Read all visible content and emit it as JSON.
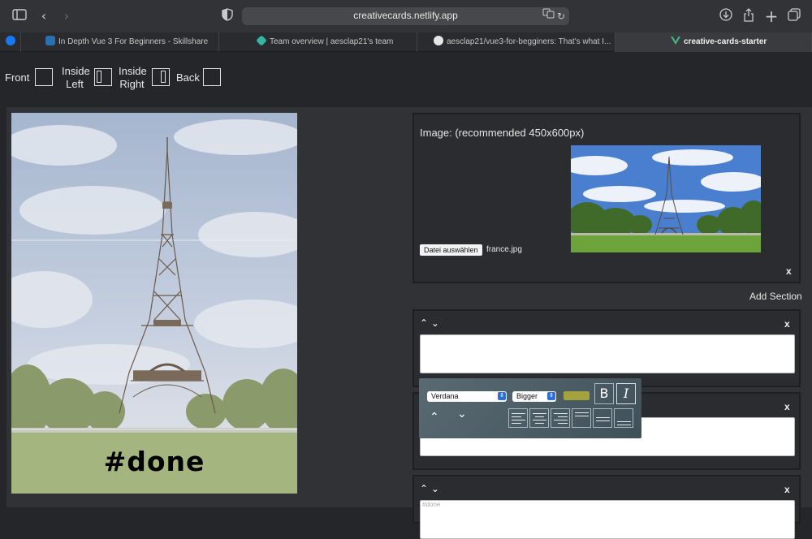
{
  "browser": {
    "url": "creativecards.netlify.app",
    "tabs": [
      {
        "label": "In Depth Vue 3 For Beginners - Skillshare",
        "icon_color": "#2a6fb0"
      },
      {
        "label": "Team overview | aesclap21's team",
        "icon_color": "#32b5a1"
      },
      {
        "label": "aesclap21/vue3-for-begginers: That's what I...",
        "icon_color": "#e6e6e6"
      },
      {
        "label": "creative-cards-starter",
        "icon_color": "#42b883"
      }
    ]
  },
  "pages": {
    "front": "Front",
    "inside_left": "Inside\nLeft",
    "inside_right": "Inside\nRight",
    "back": "Back"
  },
  "card": {
    "text": "#done"
  },
  "image_section": {
    "title": "Image: (recommended 450x600px)",
    "file_button": "Datei auswählen",
    "file_name": "france.jpg",
    "close": "x"
  },
  "add_section": "Add Section",
  "text_sections": [
    {
      "close": "x",
      "value": "",
      "placeholder": ""
    },
    {
      "close": "x",
      "value": "",
      "placeholder": ""
    },
    {
      "close": "x",
      "value": "",
      "placeholder": "#done"
    }
  ],
  "format_popup": {
    "font": "Verdana",
    "size": "Bigger",
    "color": "#a3a23f",
    "bold": "B",
    "italic": "I"
  }
}
